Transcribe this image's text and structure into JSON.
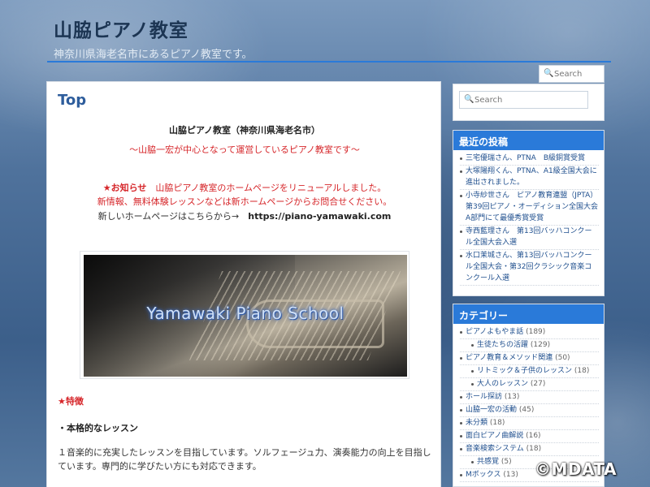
{
  "header": {
    "site_title": "山脇ピアノ教室",
    "site_desc": "神奈川県海老名市にあるピアノ教室です。"
  },
  "top_search": {
    "placeholder": "Search"
  },
  "main": {
    "page_title": "Top",
    "line1": "山脇ピアノ教室（神奈川県海老名市）",
    "line2": "～山脇一宏が中心となって運営しているピアノ教室です～",
    "notice_label": "★お知らせ",
    "notice_text": "山脇ピアノ教室のホームページをリニューアルしました。",
    "line4": "新情報、無料体験レッスンなどは新ホームページからお問合せください。",
    "line5_text": "新しいホームページはこちらから→",
    "line5_url": "https://piano-yamawaki.com",
    "hero_text": "Yamawaki Piano School",
    "features_heading": "★特徴",
    "feature1_title": "・本格的なレッスン",
    "feature1_body": "１音楽的に充実したレッスンを目指しています。ソルフェージュ力、演奏能力の向上を目指しています。専門的に学びたい方にも対応できます。"
  },
  "sidebar": {
    "search_placeholder": "Search",
    "recent_title": "最近の投稿",
    "recent_posts": [
      "三宅優瑞さん、PTNA　B級銅賞受賞",
      "大塚陽翔くん、PTNA、A1級全国大会に進出されました。",
      "小寺紗世さん　ピアノ教育連盟（JPTA）第39回ピアノ・オーディション全国大会A部門にて最優秀賞受賞",
      "寺西藍理さん　第13回バッハコンクール全国大会入選",
      "水口茉城さん、第13回バッハコンクール全国大会・第32回クラシック音楽コンクール入選"
    ],
    "categories_title": "カテゴリー",
    "categories": [
      {
        "label": "ピアノよもやま話",
        "count": "(189)",
        "sub": false
      },
      {
        "label": "生徒たちの活躍",
        "count": "(129)",
        "sub": true
      },
      {
        "label": "ピアノ教育＆メソッド関連",
        "count": "(50)",
        "sub": false
      },
      {
        "label": "リトミック＆子供のレッスン",
        "count": "(18)",
        "sub": true
      },
      {
        "label": "大人のレッスン",
        "count": "(27)",
        "sub": true
      },
      {
        "label": "ホール探訪",
        "count": "(13)",
        "sub": false
      },
      {
        "label": "山脇一宏の活動",
        "count": "(45)",
        "sub": false
      },
      {
        "label": "未分類",
        "count": "(18)",
        "sub": false
      },
      {
        "label": "面白ピアノ曲解説",
        "count": "(16)",
        "sub": false
      },
      {
        "label": "音楽検索システム",
        "count": "(18)",
        "sub": false
      },
      {
        "label": "共感覚",
        "count": "(5)",
        "sub": true
      },
      {
        "label": "Mボックス",
        "count": "(13)",
        "sub": false
      }
    ]
  },
  "watermark": "©MDATA"
}
